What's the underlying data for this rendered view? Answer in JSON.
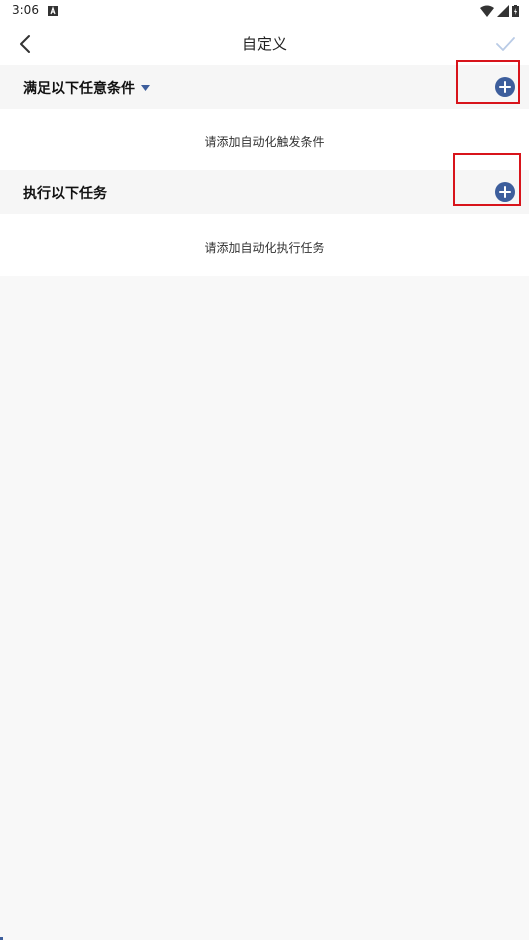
{
  "status_bar": {
    "time": "3:06"
  },
  "app_bar": {
    "title": "自定义",
    "back_icon": "chevron-left-icon",
    "confirm_icon": "check-icon"
  },
  "conditions": {
    "title": "满足以下任意条件",
    "empty_text": "请添加自动化触发条件",
    "add_icon": "plus-circle-icon"
  },
  "tasks": {
    "title": "执行以下任务",
    "empty_text": "请添加自动化执行任务",
    "add_icon": "plus-circle-icon"
  },
  "colors": {
    "accent": "#3d5e9c",
    "highlight": "#d8141b",
    "page_background": "#f8f8f8"
  }
}
